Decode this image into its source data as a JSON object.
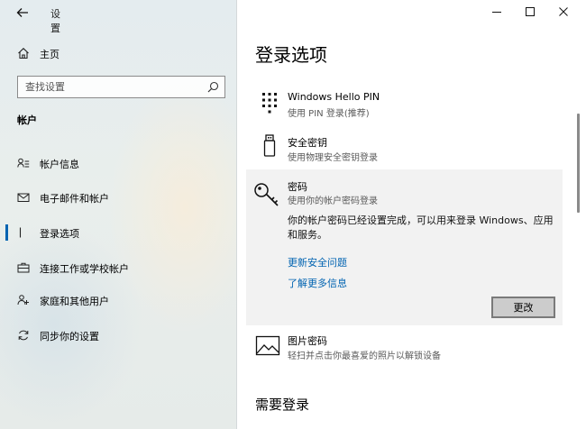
{
  "window": {
    "title": "设置",
    "controls": {
      "minimize": "minimize-icon",
      "maximize": "maximize-icon",
      "close": "close-icon"
    }
  },
  "sidebar": {
    "home_label": "主页",
    "search_placeholder": "查找设置",
    "section_title": "帐户",
    "items": [
      {
        "label": "帐户信息",
        "icon": "account-info-icon"
      },
      {
        "label": "电子邮件和帐户",
        "icon": "email-icon"
      },
      {
        "label": "登录选项",
        "icon": "key-icon",
        "selected": true
      },
      {
        "label": "连接工作或学校帐户",
        "icon": "briefcase-icon"
      },
      {
        "label": "家庭和其他用户",
        "icon": "family-icon"
      },
      {
        "label": "同步你的设置",
        "icon": "sync-icon"
      }
    ]
  },
  "main": {
    "page_title": "登录选项",
    "options": [
      {
        "title": "Windows Hello PIN",
        "subtitle": "使用 PIN 登录(推荐)",
        "icon": "pin-keypad-icon"
      },
      {
        "title": "安全密钥",
        "subtitle": "使用物理安全密钥登录",
        "icon": "usb-key-icon"
      }
    ],
    "password": {
      "title": "密码",
      "subtitle": "使用你的帐户密码登录",
      "icon": "password-key-icon",
      "description": "你的帐户密码已经设置完成，可以用来登录 Windows、应用和服务。",
      "link_update": "更新安全问题",
      "link_learn": "了解更多信息",
      "change_button": "更改"
    },
    "picture_password": {
      "title": "图片密码",
      "subtitle": "轻扫并点击你最喜爱的照片以解锁设备",
      "icon": "picture-icon"
    },
    "section2_title": "需要登录"
  },
  "colors": {
    "accent": "#0063b1",
    "selected_bar": "#0063b1",
    "expanded_bg": "#f2f2f2"
  }
}
